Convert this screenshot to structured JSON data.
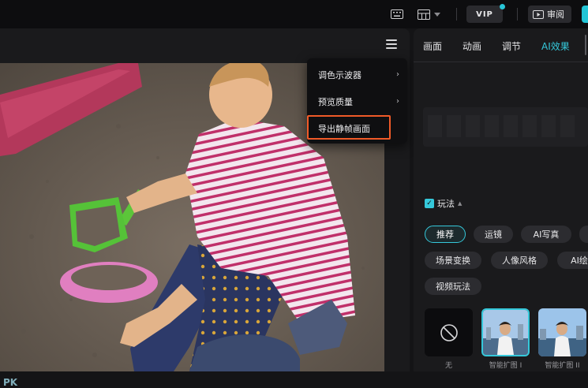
{
  "topbar": {
    "vip_label": "VIP",
    "review_label": "审阅",
    "icons": [
      "keyboard-icon",
      "layout-icon",
      "chevron-down-icon",
      "play-box-icon"
    ]
  },
  "player": {
    "menu": {
      "items": [
        {
          "label": "调色示波器",
          "has_submenu": true
        },
        {
          "label": "预览质量",
          "has_submenu": true
        },
        {
          "label": "导出静帧画面",
          "has_submenu": false,
          "highlighted": true
        }
      ],
      "chevron": "›"
    },
    "watermark": "PK"
  },
  "right_panel": {
    "tabs": [
      {
        "label": "画面",
        "active": false
      },
      {
        "label": "动画",
        "active": false
      },
      {
        "label": "调节",
        "active": false
      },
      {
        "label": "AI效果",
        "active": true
      }
    ],
    "section_label": "玩法",
    "section_checked": true,
    "chips_row1": [
      {
        "label": "推荐",
        "active": true
      },
      {
        "label": "运镜",
        "active": false
      },
      {
        "label": "AI写真",
        "active": false
      }
    ],
    "chips_row2": [
      {
        "label": "场景变换"
      },
      {
        "label": "人像风格"
      },
      {
        "label": "AI绘"
      }
    ],
    "chips_row3": [
      {
        "label": "视频玩法"
      }
    ],
    "effects": [
      {
        "label": "无",
        "selected": false
      },
      {
        "label": "智能扩图 I",
        "selected": true
      },
      {
        "label": "智能扩图 II",
        "selected": false
      }
    ]
  },
  "colors": {
    "accent": "#35c8da",
    "highlight_border": "#f05a28",
    "panel_bg": "#1a1a1c",
    "menu_bg": "#0f0f11"
  }
}
